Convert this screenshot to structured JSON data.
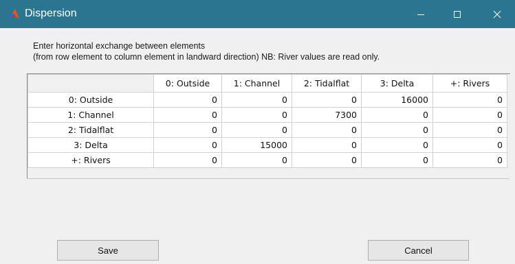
{
  "window": {
    "title": "Dispersion",
    "controls": {
      "minimize": "minimize-icon",
      "maximize": "maximize-icon",
      "close": "close-icon"
    }
  },
  "instructions": {
    "line1": "Enter horizontal exchange between elements",
    "line2": "(from row element to column element in landward direction) NB: River values are read only."
  },
  "table": {
    "columns": [
      "0: Outside",
      "1: Channel",
      "2: Tidalflat",
      "3: Delta",
      "+: Rivers"
    ],
    "rows": [
      {
        "label": "0: Outside",
        "values": [
          "0",
          "0",
          "0",
          "16000",
          "0"
        ]
      },
      {
        "label": "1: Channel",
        "values": [
          "0",
          "0",
          "7300",
          "0",
          "0"
        ]
      },
      {
        "label": "2: Tidalflat",
        "values": [
          "0",
          "0",
          "0",
          "0",
          "0"
        ]
      },
      {
        "label": "3: Delta",
        "values": [
          "0",
          "15000",
          "0",
          "0",
          "0"
        ]
      },
      {
        "label": "+: Rivers",
        "values": [
          "0",
          "0",
          "0",
          "0",
          "0"
        ]
      }
    ]
  },
  "buttons": {
    "save": "Save",
    "cancel": "Cancel"
  },
  "colors": {
    "titlebar": "#2b7591",
    "background": "#f0f0f0"
  }
}
